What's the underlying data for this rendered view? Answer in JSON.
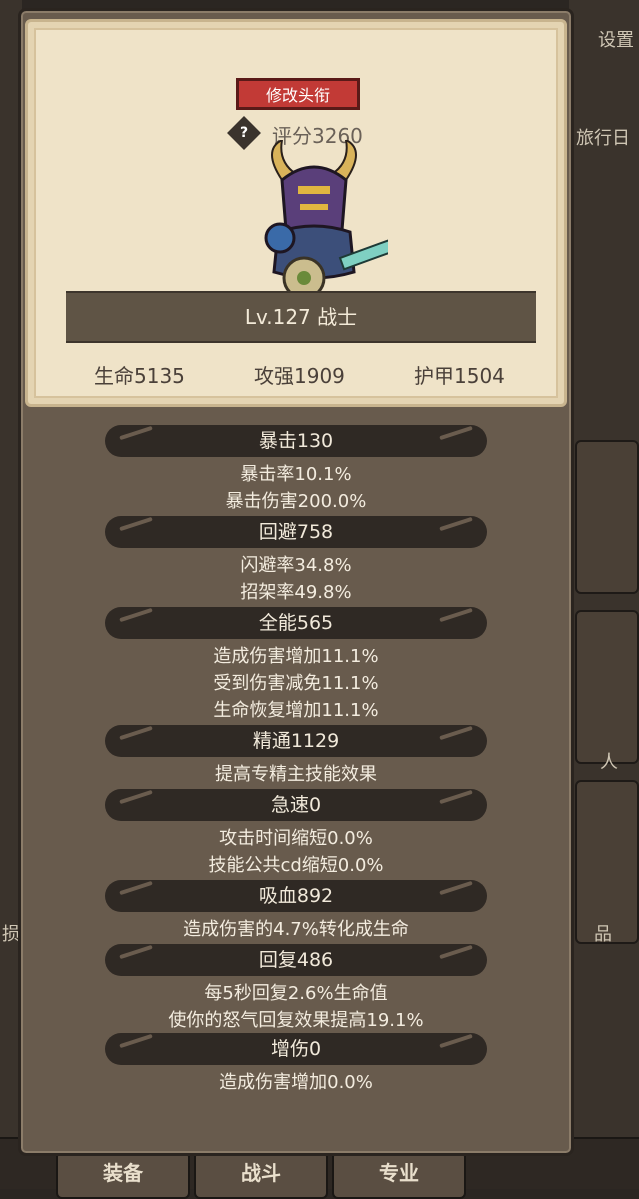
{
  "background": {
    "right_labels": [
      "设置",
      "旅行日",
      "人",
      "品"
    ],
    "left_labels": [
      "损"
    ],
    "bottom_buttons": [
      "装备",
      "战斗",
      "专业"
    ]
  },
  "card": {
    "title_button": "修改头衔",
    "help_icon": "?",
    "score": "评分3260",
    "level": "Lv.127 战士",
    "stats": {
      "hp": "生命5135",
      "attack": "攻强1909",
      "armor": "护甲1504"
    }
  },
  "attributes": [
    {
      "name": "暴击130",
      "lines": [
        "暴击率10.1%",
        "暴击伤害200.0%"
      ]
    },
    {
      "name": "回避758",
      "lines": [
        "闪避率34.8%",
        "招架率49.8%"
      ]
    },
    {
      "name": "全能565",
      "lines": [
        "造成伤害增加11.1%",
        "受到伤害减免11.1%",
        "生命恢复增加11.1%"
      ]
    },
    {
      "name": "精通1129",
      "lines": [
        "提高专精主技能效果"
      ]
    },
    {
      "name": "急速0",
      "lines": [
        "攻击时间缩短0.0%",
        "技能公共cd缩短0.0%"
      ]
    },
    {
      "name": "吸血892",
      "lines": [
        "造成伤害的4.7%转化成生命"
      ]
    },
    {
      "name": "回复486",
      "lines": [
        "每5秒回复2.6%生命值",
        "使你的怒气回复效果提高19.1%"
      ]
    },
    {
      "name": "增伤0",
      "lines": [
        "造成伤害增加0.0%"
      ]
    }
  ],
  "colors": {
    "title_button": "#c23a36",
    "panel": "#685b4d",
    "card": "#efe3c8",
    "pill": "#2f2924"
  }
}
